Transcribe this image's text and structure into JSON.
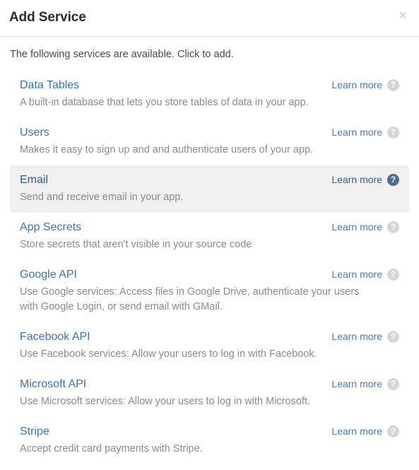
{
  "dialog": {
    "title": "Add Service",
    "close_label": "×",
    "intro": "The following services are available. Click to add.",
    "learn_more_label": "Learn more",
    "help_icon_glyph": "?"
  },
  "colors": {
    "link_blue": "#3b73b9",
    "hover_background": "#f0f0f0",
    "help_icon_default": "#d4d7da",
    "help_icon_active": "#4e6e8e",
    "description_gray": "#8b8b8b",
    "title_dark": "#2b2b2b"
  },
  "services": [
    {
      "name": "Data Tables",
      "description": "A built-in database that lets you store tables of data in your app.",
      "hovered": false
    },
    {
      "name": "Users",
      "description": "Makes it easy to sign up and and authenticate users of your app.",
      "hovered": false
    },
    {
      "name": "Email",
      "description": "Send and receive email in your app.",
      "hovered": true
    },
    {
      "name": "App Secrets",
      "description": "Store secrets that aren't visible in your source code",
      "hovered": false
    },
    {
      "name": "Google API",
      "description": "Use Google services: Access files in Google Drive, authenticate your users with Google Login, or send email with GMail.",
      "hovered": false
    },
    {
      "name": "Facebook API",
      "description": "Use Facebook services: Allow your users to log in with Facebook.",
      "hovered": false
    },
    {
      "name": "Microsoft API",
      "description": "Use Microsoft services: Allow your users to log in with Microsoft.",
      "hovered": false
    },
    {
      "name": "Stripe",
      "description": "Accept credit card payments with Stripe.",
      "hovered": false
    }
  ]
}
